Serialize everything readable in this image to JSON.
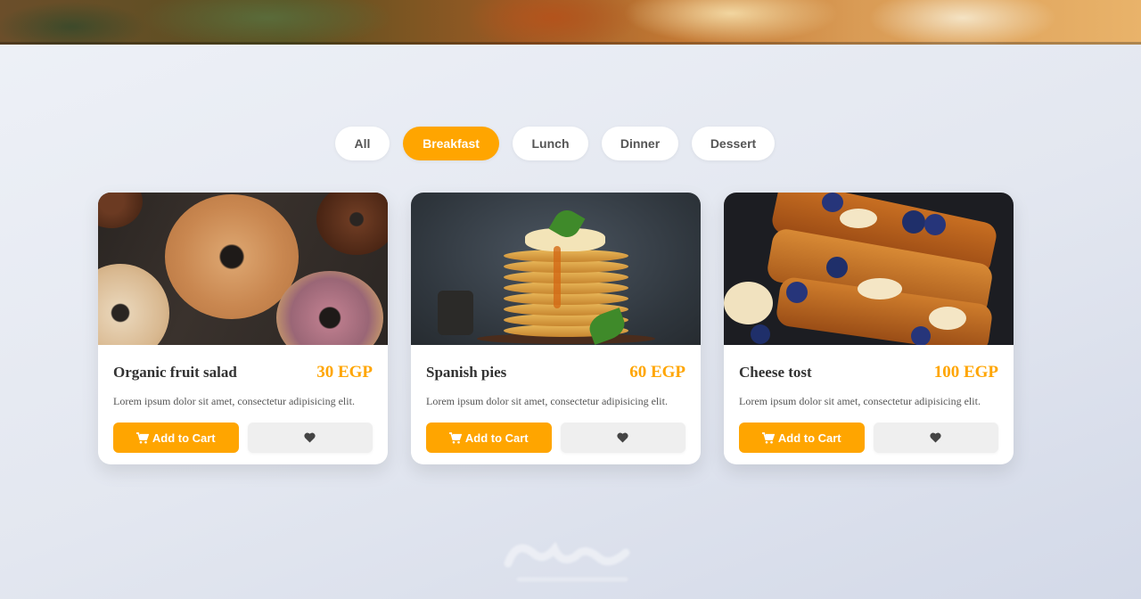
{
  "filters": [
    {
      "label": "All",
      "active": false
    },
    {
      "label": "Breakfast",
      "active": true
    },
    {
      "label": "Lunch",
      "active": false
    },
    {
      "label": "Dinner",
      "active": false
    },
    {
      "label": "Dessert",
      "active": false
    }
  ],
  "cards": [
    {
      "title": "Organic fruit salad",
      "price": "30 EGP",
      "description": "Lorem ipsum dolor sit amet, consectetur adipisicing elit.",
      "cart_label": "Add to Cart",
      "image": "donuts"
    },
    {
      "title": "Spanish pies",
      "price": "60 EGP",
      "description": "Lorem ipsum dolor sit amet, consectetur adipisicing elit.",
      "cart_label": "Add to Cart",
      "image": "pancakes"
    },
    {
      "title": "Cheese tost",
      "price": "100 EGP",
      "description": "Lorem ipsum dolor sit amet, consectetur adipisicing elit.",
      "cart_label": "Add to Cart",
      "image": "french-toast"
    }
  ],
  "icons": {
    "cart": "shopping-cart-icon",
    "favorite": "heart-icon"
  },
  "colors": {
    "accent": "#ffa500",
    "text": "#333333",
    "muted": "#555555",
    "fav_bg": "#efefef"
  }
}
